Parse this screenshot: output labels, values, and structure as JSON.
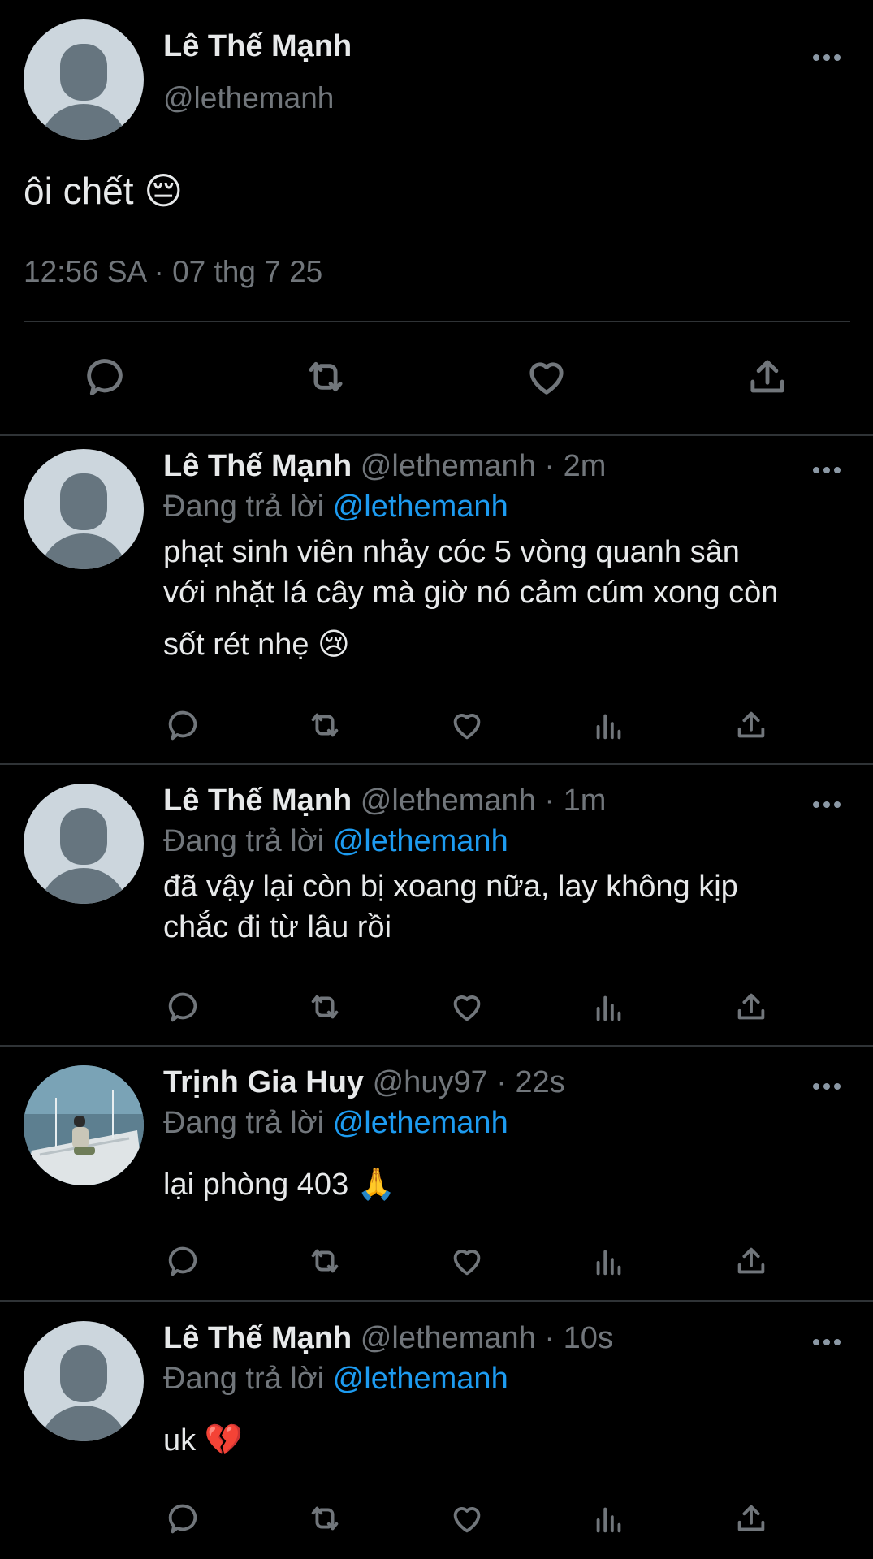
{
  "main_tweet": {
    "name": "Lê Thế Mạnh",
    "handle": "@lethemanh",
    "text": "ôi chết 😔",
    "timestamp": "12:56 SA · 07 thg 7 25",
    "actions": [
      "reply-icon",
      "retweet-icon",
      "like-icon",
      "share-icon"
    ]
  },
  "replies": [
    {
      "name": "Lê Thế Mạnh",
      "handle": "@lethemanh",
      "time": "2m",
      "replying_label": "Đang trả lời",
      "replying_to": "@lethemanh",
      "text_lines": [
        "phạt sinh viên nhảy cóc 5 vòng quanh sân",
        "với nhặt lá cây mà giờ nó cảm cúm xong còn",
        "sốt rét nhẹ 😢"
      ],
      "avatar": "default"
    },
    {
      "name": "Lê Thế Mạnh",
      "handle": "@lethemanh",
      "time": "1m",
      "replying_label": "Đang trả lời",
      "replying_to": "@lethemanh",
      "text_lines": [
        "đã vậy lại còn bị xoang nữa, lay không kịp",
        "chắc đi từ lâu rồi"
      ],
      "avatar": "default"
    },
    {
      "name": "Trịnh Gia Huy",
      "handle": "@huy97",
      "time": "22s",
      "replying_label": "Đang trả lời",
      "replying_to": "@lethemanh",
      "text_lines": [
        "lại phòng 403 🙏"
      ],
      "avatar": "photo"
    },
    {
      "name": "Lê Thế Mạnh",
      "handle": "@lethemanh",
      "time": "10s",
      "replying_label": "Đang trả lời",
      "replying_to": "@lethemanh",
      "text_lines": [
        "uk 💔"
      ],
      "avatar": "default"
    }
  ],
  "colors": {
    "background": "#000000",
    "text_primary": "#e7e9ea",
    "text_secondary": "#71767b",
    "mention": "#1d9bf0",
    "divider": "#2f3336"
  }
}
